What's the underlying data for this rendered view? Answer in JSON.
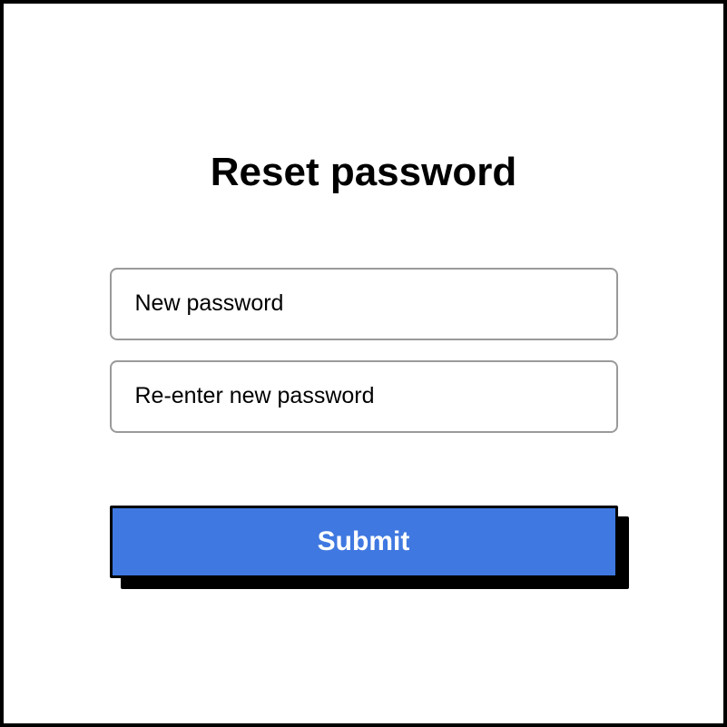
{
  "title": "Reset password",
  "fields": {
    "new_password_placeholder": "New password",
    "reenter_password_placeholder": "Re-enter new password"
  },
  "submit_label": "Submit"
}
